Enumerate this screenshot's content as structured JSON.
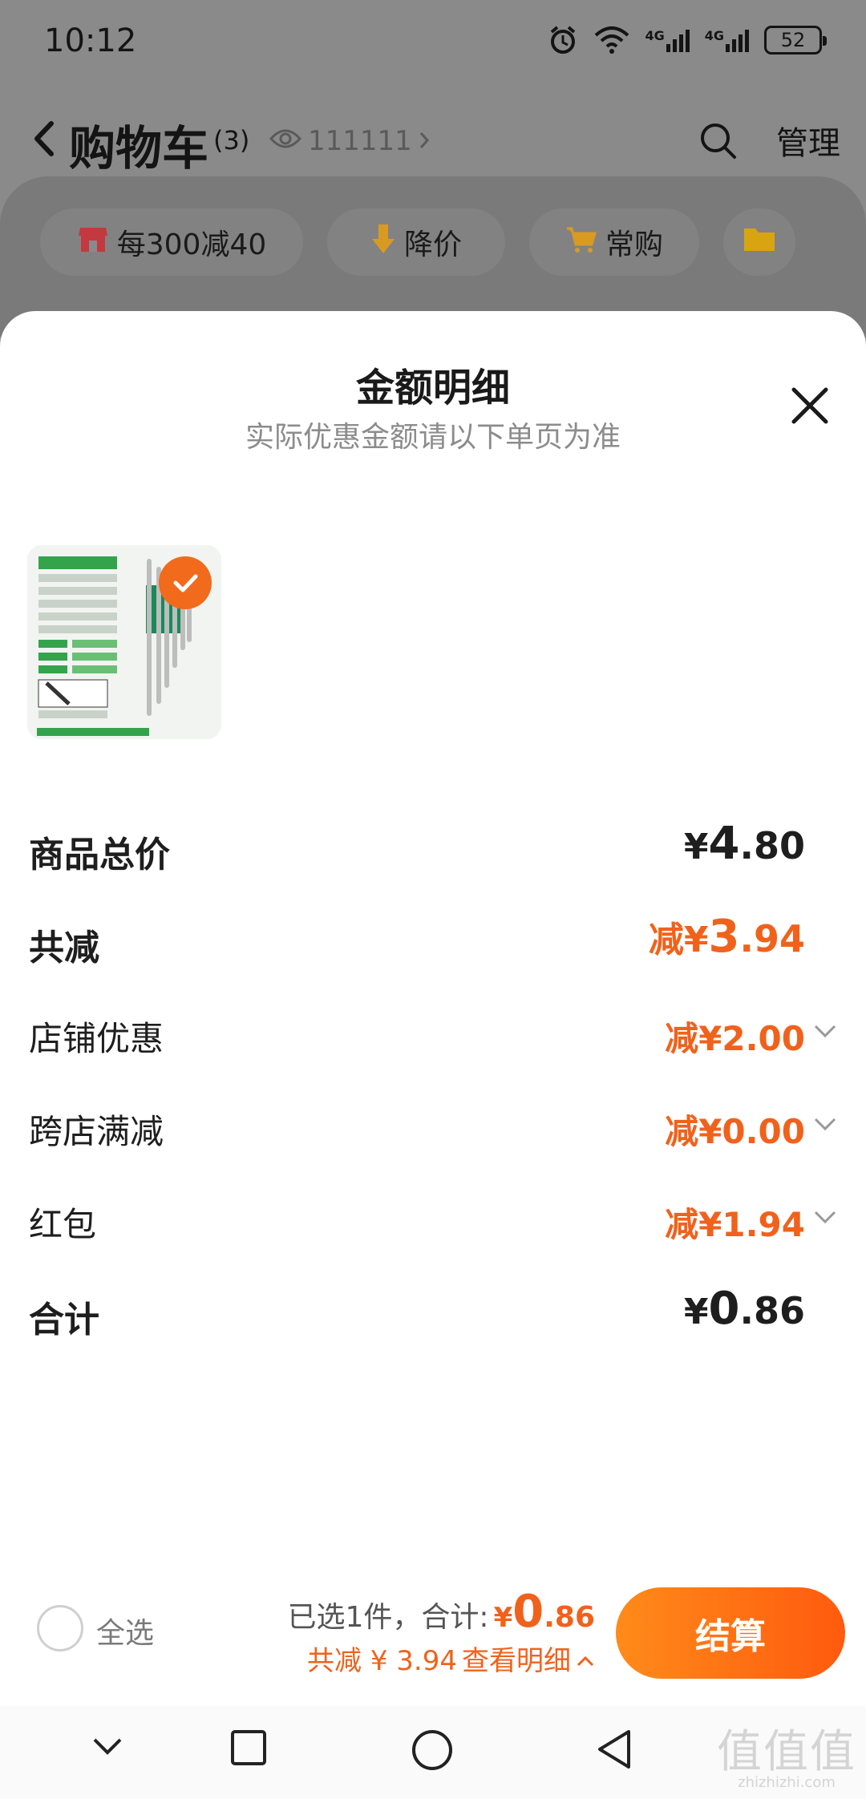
{
  "status_bar": {
    "time": "10:12",
    "network_1": "4G",
    "network_2": "4G",
    "battery": "52"
  },
  "header": {
    "title": "购物车",
    "count": "(3)",
    "followers": "111111",
    "manage_label": "管理"
  },
  "chips": [
    {
      "label": "每300减40",
      "icon": "shop-icon"
    },
    {
      "label": "降价",
      "icon": "price-drop-icon"
    },
    {
      "label": "常购",
      "icon": "cart-icon"
    },
    {
      "label": "",
      "icon": "folder-icon"
    }
  ],
  "sheet": {
    "title": "金额明细",
    "subtitle": "实际优惠金额请以下单页为准",
    "rows": [
      {
        "label": "商品总价",
        "yen": "¥",
        "int": "4",
        "dec": ".80",
        "prefix": ""
      },
      {
        "label": "共减",
        "yen": "¥",
        "int": "3",
        "dec": ".94",
        "prefix": "减"
      },
      {
        "label": "店铺优惠",
        "value": "减¥2.00"
      },
      {
        "label": "跨店满减",
        "value": "减¥0.00"
      },
      {
        "label": "红包",
        "value": "减¥1.94"
      },
      {
        "label": "合计",
        "yen": "¥",
        "int": "0",
        "dec": ".86",
        "prefix": ""
      }
    ]
  },
  "checkout": {
    "select_all_label": "全选",
    "selected_text": "已选1件，合计:",
    "total_yen": "¥",
    "total_int": "0",
    "total_dec": ".86",
    "discount_text": "共减 ¥ 3.94",
    "detail_link": "查看明细",
    "checkout_label": "结算"
  },
  "watermark": {
    "big": "值值值",
    "small": "zhizhizhi.com"
  },
  "colors": {
    "accent": "#f0621c",
    "checkout_start": "#ff8b1a",
    "checkout_end": "#ff5a0e"
  }
}
